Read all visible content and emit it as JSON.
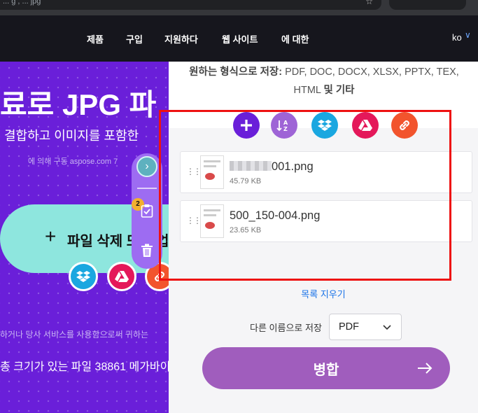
{
  "browser": {
    "url_fragment": "... g , ... jpg"
  },
  "nav": {
    "items": [
      "제품",
      "구입",
      "지원하다",
      "웹 사이트",
      "에 대한"
    ],
    "lang": "ko",
    "lang_chevron": "∨"
  },
  "hero": {
    "title": "료로 JPG 파",
    "subtitle": "결합하고 이미지를 포함한",
    "powered_by": "에 의해 구동 aspose.com 7",
    "drop_button": "파일 삭제 또는 업",
    "terms_note": "하거나 당사 서비스를 사용함으로써 귀하는",
    "size_note": "총 크기가 있는 파일 38861 메가바이"
  },
  "toolbar": {
    "file_count": "2"
  },
  "formats": {
    "label": "원하는 형식으로 저장:",
    "list": "PDF, DOC, DOCX, XLSX, PPTX, TEX, HTML",
    "and": "및",
    "more": "기타"
  },
  "files": [
    {
      "name_visible": "001.png",
      "size": "45.79 KB",
      "name_blurred": true
    },
    {
      "name_visible": "500_150-004.png",
      "size": "23.65 KB",
      "name_blurred": false
    }
  ],
  "actions": {
    "clear_list": "목록 지우기",
    "save_as_label": "다른 이름으로 저장",
    "format_value": "PDF",
    "merge_button": "병합"
  },
  "colors": {
    "hero_bg": "#6a1fd9",
    "pill_bg": "#8ee6de",
    "add_icon": "#6a1fd9",
    "sort_icon": "#9e64d6",
    "dropbox": "#1aa7e0",
    "gdrive": "#e4185a",
    "url": "#f2542d",
    "merge_button": "#a05dbd",
    "highlight": "#ee1111"
  },
  "icons": [
    "plus-icon",
    "sort-az-icon",
    "dropbox-icon",
    "google-drive-icon",
    "link-icon",
    "chevron-right-icon",
    "checklist-icon",
    "trash-icon",
    "grip-icon",
    "arrow-right-icon"
  ]
}
